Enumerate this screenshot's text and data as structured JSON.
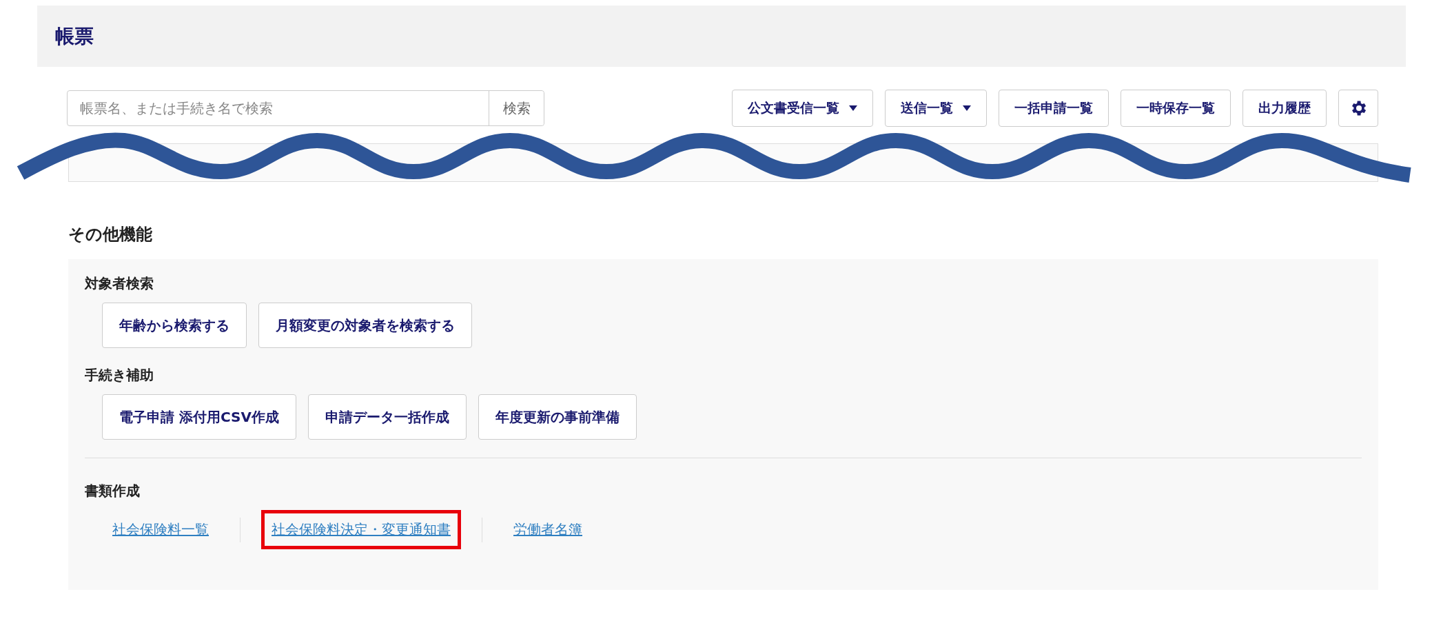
{
  "header": {
    "title": "帳票"
  },
  "search": {
    "placeholder": "帳票名、または手続き名で検索",
    "button": "検索"
  },
  "toolbar": [
    {
      "label": "公文書受信一覧",
      "kind": "dropdown"
    },
    {
      "label": "送信一覧",
      "kind": "dropdown"
    },
    {
      "label": "一括申請一覧",
      "kind": "button"
    },
    {
      "label": "一時保存一覧",
      "kind": "button"
    },
    {
      "label": "出力履歴",
      "kind": "button"
    },
    {
      "kind": "settings"
    }
  ],
  "other": {
    "title": "その他機能",
    "groups": [
      {
        "title": "対象者検索",
        "kind": "buttons",
        "items": [
          {
            "label": "年齢から検索する"
          },
          {
            "label": "月額変更の対象者を検索する"
          }
        ]
      },
      {
        "title": "手続き補助",
        "kind": "buttons",
        "items": [
          {
            "label": "電子申請 添付用CSV作成"
          },
          {
            "label": "申請データ一括作成"
          },
          {
            "label": "年度更新の事前準備"
          }
        ]
      },
      {
        "title": "書類作成",
        "kind": "links",
        "items": [
          {
            "label": "社会保険料一覧",
            "highlighted": false
          },
          {
            "label": "社会保険料決定・変更通知書",
            "highlighted": true
          },
          {
            "label": "労働者名簿",
            "highlighted": false
          }
        ]
      }
    ]
  }
}
